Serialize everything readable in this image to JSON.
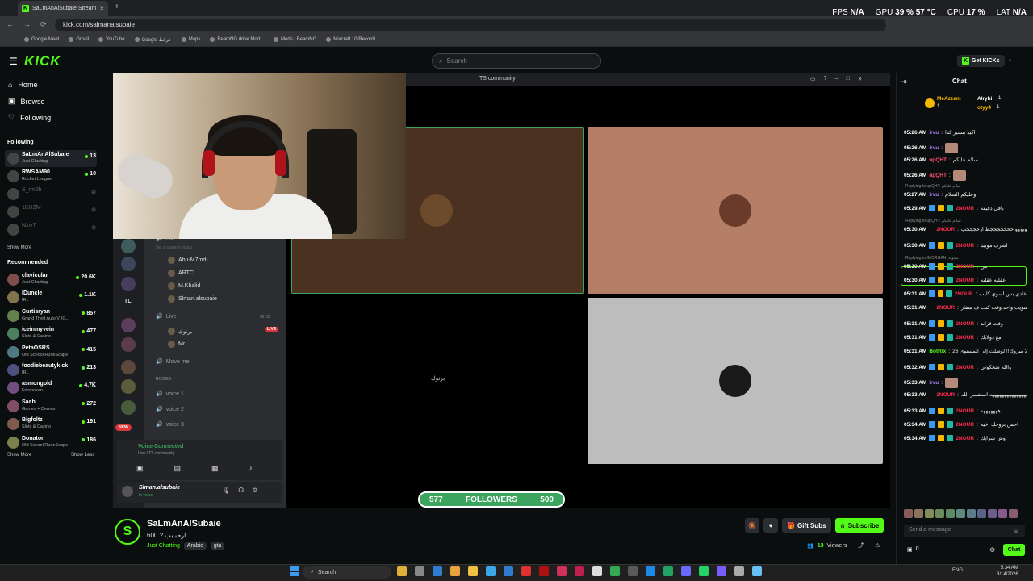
{
  "browser": {
    "tab_title": "SaLmAnAlSubaie Stream",
    "url": "kick.com/salmanalsubaie",
    "bookmarks": [
      "Google Meet",
      "Gmail",
      "YouTube",
      "Google خرائط",
      "Maps",
      "BeamNG.drive Mod...",
      "Mods | BeamNG",
      "Mixcraft 10 Recordi..."
    ]
  },
  "overlay": {
    "fps_label": "FPS",
    "fps": "N/A",
    "gpu_label": "GPU",
    "gpu": "39 % 57 °C",
    "cpu_label": "CPU",
    "cpu": "17 %",
    "lat_label": "LAT",
    "lat": "N/A"
  },
  "kick": {
    "logo": "KICK",
    "search_placeholder": "Search",
    "get_kicks": "Get KICKs"
  },
  "sidebar": {
    "nav": [
      {
        "label": "Home",
        "icon": "home-icon"
      },
      {
        "label": "Browse",
        "icon": "browse-icon"
      },
      {
        "label": "Following",
        "icon": "heart-icon"
      }
    ],
    "following_title": "Following",
    "following": [
      {
        "name": "SaLmAnAlSubaie",
        "sub": "Just Chatting",
        "count": "13",
        "live": true
      },
      {
        "name": "RWSAM90",
        "sub": "Rocket League",
        "count": "10",
        "live": true
      },
      {
        "name": "S_rm0h",
        "sub": "",
        "count": "",
        "live": false
      },
      {
        "name": "1KUZM",
        "sub": "",
        "count": "",
        "live": false
      },
      {
        "name": "Nxiv7",
        "sub": "",
        "count": "",
        "live": false
      }
    ],
    "show_more_1": "Show More",
    "recommended_title": "Recommended",
    "recommended": [
      {
        "name": "clavicular",
        "sub": "Just Chatting",
        "count": "20.6K"
      },
      {
        "name": "IDuncle",
        "sub": "IRL",
        "count": "1.1K"
      },
      {
        "name": "Curtisryan",
        "sub": "Grand Theft Auto V (G...",
        "count": "857"
      },
      {
        "name": "iceinmyvein",
        "sub": "Slots & Casino",
        "count": "477"
      },
      {
        "name": "PetaOSRS",
        "sub": "Old School RuneScape",
        "count": "415"
      },
      {
        "name": "foodiebeautykick",
        "sub": "IRL",
        "count": "213"
      },
      {
        "name": "asmongold",
        "sub": "Forspoken",
        "count": "4.7K"
      },
      {
        "name": "Saab",
        "sub": "Games + Demos",
        "count": "272"
      },
      {
        "name": "Bigfoltz",
        "sub": "Slots & Casino",
        "count": "191"
      },
      {
        "name": "Donator",
        "sub": "Old School RuneScape",
        "count": "186"
      }
    ],
    "show_more_2": "Show More",
    "show_less": "Show Less"
  },
  "discord": {
    "window_title": "TS community",
    "channels": [
      {
        "label": "Live",
        "type": "voice",
        "user": false
      },
      {
        "label": "Set a channel status",
        "type": "status",
        "user": false
      },
      {
        "label": "Abu-M7md-",
        "type": "user",
        "user": true
      },
      {
        "label": "ARTC",
        "type": "user",
        "user": true
      },
      {
        "label": "M.Khalid",
        "type": "user",
        "user": true
      },
      {
        "label": "Slman.alsubaie",
        "type": "user",
        "user": true
      },
      {
        "label": "Live",
        "type": "voice",
        "user": false
      },
      {
        "label": "برنوك",
        "type": "user",
        "user": true
      },
      {
        "label": "Mr",
        "type": "user",
        "user": true
      },
      {
        "label": "Move me",
        "type": "voice",
        "user": false
      },
      {
        "label": "ROOMS",
        "type": "category",
        "user": false
      },
      {
        "label": "voice 1",
        "type": "voice",
        "user": false
      },
      {
        "label": "voice 2",
        "type": "voice",
        "user": false
      },
      {
        "label": "voice 3",
        "type": "voice",
        "user": false
      }
    ],
    "live_badge": "LIVE",
    "new_badge": "NEW",
    "tl_label": "TL",
    "counts": "02   33",
    "voice_connected": "Voice Connected",
    "voice_channel": "Live / TS community",
    "username": "Slman.alsubaie",
    "user_status": "In voice",
    "tile_label": "برنوك"
  },
  "followers_bar": {
    "current": "577",
    "label": "FOLLOWERS",
    "goal": "500"
  },
  "stream": {
    "channel": "SaLmAnAlSubaie",
    "title": "600 ? ارحبببب",
    "category": "Just Chatting",
    "tags": [
      "Arabic",
      "gta"
    ],
    "viewers": "13",
    "viewers_label": "Viewers",
    "gift_subs": "Gift Subs",
    "subscribe": "Subscribe"
  },
  "chat": {
    "title": "Chat",
    "pinned_users": [
      {
        "name": "MeAzzam",
        "num": "1"
      },
      {
        "name": "Alryhi",
        "num": "1"
      },
      {
        "name": "otyy4",
        "num": "1"
      }
    ],
    "messages": [
      {
        "time": "05:26 AM",
        "user": "irvu",
        "color": "#b47cff",
        "msg": "اكيد بتسير كذا",
        "emote": false,
        "reply": ""
      },
      {
        "time": "05:26 AM",
        "user": "irvu",
        "color": "#b47cff",
        "msg": "",
        "emote": true,
        "reply": ""
      },
      {
        "time": "05:26 AM",
        "user": "upQHT",
        "color": "#ff4d6d",
        "msg": "سلام عليكم",
        "emote": false,
        "reply": ""
      },
      {
        "time": "05:26 AM",
        "user": "upQHT",
        "color": "#ff4d6d",
        "msg": "",
        "emote": true,
        "reply": ""
      },
      {
        "time": "05:27 AM",
        "user": "irvu",
        "color": "#b47cff",
        "msg": "وعليكم السلام",
        "emote": false,
        "reply": "Replying to upQHT: سلام عليكم"
      },
      {
        "time": "05:29 AM",
        "user": "2NOUR",
        "color": "#ff2b4e",
        "msg": "باقي دقيقه",
        "emote": false,
        "reply": ""
      },
      {
        "time": "05:30 AM",
        "user": "2NOUR",
        "color": "#ff2b4e",
        "msg": "ابوبووو خخخججججط ارخجججب",
        "emote": false,
        "reply": "Replying to upQHT: سلام عليكم"
      },
      {
        "time": "05:30 AM",
        "user": "2NOUR",
        "color": "#ff2b4e",
        "msg": "اشرب موبيبا",
        "emote": false,
        "reply": ""
      },
      {
        "time": "05:30 AM",
        "user": "2NOUR",
        "color": "#ff2b4e",
        "msg": "من",
        "emote": false,
        "reply": "Replying to IMORGAN: بشويه"
      },
      {
        "time": "05:30 AM",
        "user": "2NOUR",
        "color": "#ff2b4e",
        "msg": "عقليه عقليه",
        "emote": false,
        "reply": ""
      },
      {
        "time": "05:31 AM",
        "user": "2NOUR",
        "color": "#ff2b4e",
        "msg": "عادي بس اسوي كليب",
        "emote": false,
        "reply": ""
      },
      {
        "time": "05:31 AM",
        "user": "2NOUR",
        "color": "#ff2b4e",
        "msg": "سويت واحد وقت كنت ف سفار",
        "emote": false,
        "reply": ""
      },
      {
        "time": "05:31 AM",
        "user": "2NOUR",
        "color": "#ff2b4e",
        "msg": "وقت قراند",
        "emote": false,
        "reply": ""
      },
      {
        "time": "05:31 AM",
        "user": "2NOUR",
        "color": "#ff2b4e",
        "msg": "مع دولابك",
        "emote": false,
        "reply": ""
      },
      {
        "time": "05:31 AM",
        "user": "BotRix",
        "color": "#53fc18",
        "msg": "@2NOUR مبروك!! لوصلت إلى المستوى 26",
        "emote": false,
        "reply": ""
      },
      {
        "time": "05:32 AM",
        "user": "2NOUR",
        "color": "#ff2b4e",
        "msg": "والله ضحكوني",
        "emote": false,
        "reply": ""
      },
      {
        "time": "05:33 AM",
        "user": "irvu",
        "color": "#b47cff",
        "msg": "",
        "emote": true,
        "reply": ""
      },
      {
        "time": "05:33 AM",
        "user": "2NOUR",
        "color": "#ff2b4e",
        "msg": "هههههههههههههههههههههه استفسر الله",
        "emote": false,
        "reply": ""
      },
      {
        "time": "05:33 AM",
        "user": "2NOUR",
        "color": "#ff2b4e",
        "msg": "هههههههه",
        "emote": false,
        "reply": ""
      },
      {
        "time": "05:34 AM",
        "user": "2NOUR",
        "color": "#ff2b4e",
        "msg": "احس بروحك اخيه",
        "emote": false,
        "reply": ""
      },
      {
        "time": "05:34 AM",
        "user": "2NOUR",
        "color": "#ff2b4e",
        "msg": "وش شرايك",
        "emote": false,
        "reply": ""
      }
    ],
    "send_placeholder": "Send a message",
    "points": "0",
    "chat_button": "Chat"
  },
  "taskbar": {
    "search": "Search",
    "lang": "ENG",
    "time": "5:34 AM",
    "date": "3/14/2026"
  }
}
